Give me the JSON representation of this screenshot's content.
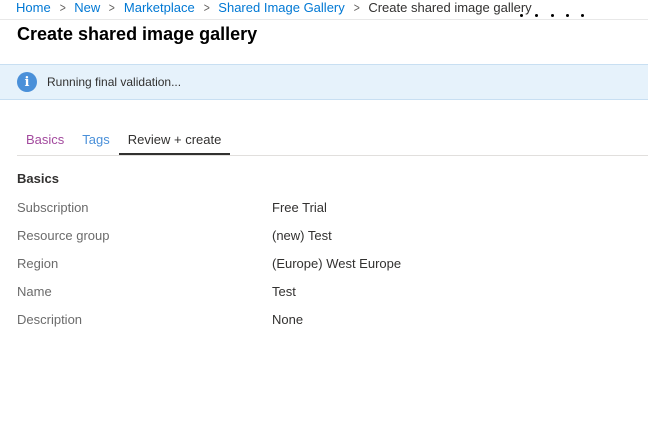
{
  "breadcrumb": {
    "items": [
      "Home",
      "New",
      "Marketplace",
      "Shared Image Gallery"
    ],
    "current": "Create shared image gallery"
  },
  "page": {
    "title": "Create shared image gallery"
  },
  "banner": {
    "icon": "info-icon",
    "text": "Running final validation..."
  },
  "tabs": [
    {
      "label": "Basics"
    },
    {
      "label": "Tags"
    },
    {
      "label": "Review + create"
    }
  ],
  "section": {
    "title": "Basics",
    "rows": [
      {
        "label": "Subscription",
        "value": "Free Trial"
      },
      {
        "label": "Resource group",
        "value": "(new) Test"
      },
      {
        "label": "Region",
        "value": "(Europe) West Europe"
      },
      {
        "label": "Name",
        "value": "Test"
      },
      {
        "label": "Description",
        "value": "None"
      }
    ]
  }
}
